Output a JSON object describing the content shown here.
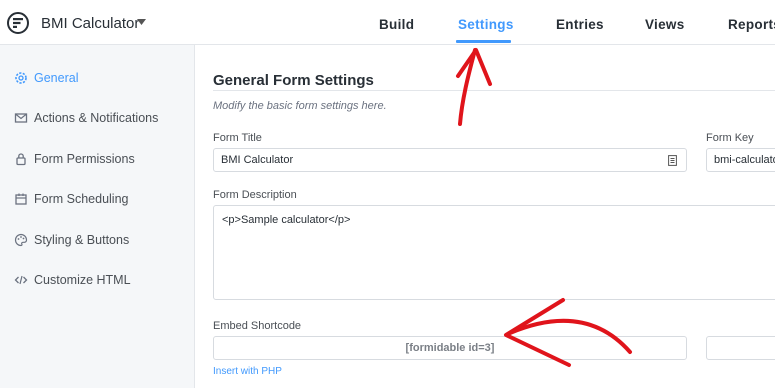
{
  "header": {
    "form_name": "BMI Calculator",
    "tabs": [
      {
        "label": "Build",
        "active": false
      },
      {
        "label": "Settings",
        "active": true
      },
      {
        "label": "Entries",
        "active": false
      },
      {
        "label": "Views",
        "active": false
      },
      {
        "label": "Reports",
        "active": false
      }
    ]
  },
  "sidebar": {
    "items": [
      {
        "label": "General",
        "icon": "gear-icon",
        "active": true
      },
      {
        "label": "Actions & Notifications",
        "icon": "envelope-icon",
        "active": false
      },
      {
        "label": "Form Permissions",
        "icon": "lock-icon",
        "active": false
      },
      {
        "label": "Form Scheduling",
        "icon": "calendar-icon",
        "active": false
      },
      {
        "label": "Styling & Buttons",
        "icon": "palette-icon",
        "active": false
      },
      {
        "label": "Customize HTML",
        "icon": "code-icon",
        "active": false
      }
    ]
  },
  "main": {
    "title": "General Form Settings",
    "subtitle": "Modify the basic form settings here.",
    "form_title_label": "Form Title",
    "form_title_value": "BMI Calculator",
    "form_key_label": "Form Key",
    "form_key_value": "bmi-calculator",
    "description_label": "Form Description",
    "description_value": "<p>Sample calculator</p>",
    "embed_label": "Embed Shortcode",
    "embed_value": "[formidable id=3]",
    "php_link": "Insert with PHP"
  },
  "colors": {
    "accent": "#4199fd",
    "annotation": "#e0141b",
    "sidebar_bg": "#f5f7f9"
  }
}
